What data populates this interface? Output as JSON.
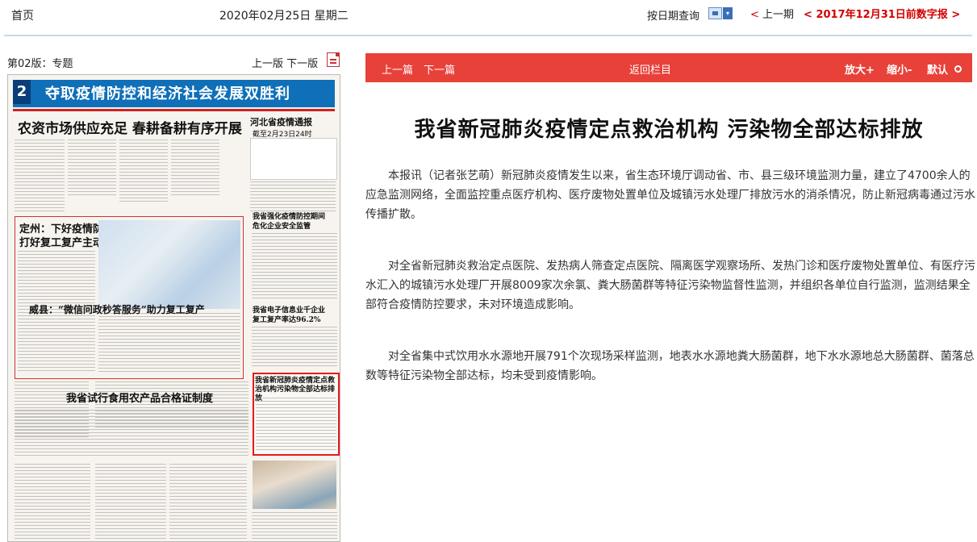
{
  "topbar": {
    "home": "首页",
    "date": "2020年02月25日 星期二",
    "query_by_date": "按日期查询",
    "calendar_icon": "calendar-icon",
    "prev_day_arrow": "<",
    "prev_day": "上一期",
    "back_to_2017_arrow": "<",
    "back_to_2017": "2017年12月31日前数字报",
    "back_to_2017_arrow_right": ">"
  },
  "left": {
    "section": "第02版：专题",
    "prev_page": "上一版",
    "next_page": "下一版",
    "pdf_icon": "pdf-icon",
    "paper": {
      "page_no": "2",
      "banner": "夺取疫情防控和经济社会发展双胜利",
      "headline_1": "农资市场供应充足 春耕备耕有序开展",
      "headline_right": "河北省疫情通报",
      "headline_right_2": "截至2月23日24时",
      "headline_2": "定州：下好疫情防控先手棋",
      "headline_2b": "打好复工复产主动仗",
      "headline_3": "威县：“微信问政秒答服务”助力复工复产",
      "headline_4": "我省试行食用农产品合格证制度",
      "headline_5": "我省强化疫情防控期间",
      "headline_5b": "危化企业安全监管",
      "headline_6": "我省电子信息业千企业",
      "headline_6b": "复工复产率达96.2%",
      "highlight_title": "我省新冠肺炎疫情定点救治机构污染物全部达标排放"
    }
  },
  "article": {
    "toolbar": {
      "prev": "上一篇",
      "next": "下一篇",
      "back": "返回栏目",
      "zoom_in": "放大+",
      "zoom_out": "缩小-",
      "default": "默认"
    },
    "title": "我省新冠肺炎疫情定点救治机构 污染物全部达标排放",
    "paragraphs": [
      "本报讯（记者张艺萌）新冠肺炎疫情发生以来，省生态环境厅调动省、市、县三级环境监测力量，建立了4700余人的应急监测网络，全面监控重点医疗机构、医疗废物处置单位及城镇污水处理厂排放污水的消杀情况，防止新冠病毒通过污水传播扩散。",
      "对全省新冠肺炎救治定点医院、发热病人筛查定点医院、隔离医学观察场所、发热门诊和医疗废物处置单位、有医疗污水汇入的城镇污水处理厂开展8009家次余氯、粪大肠菌群等特征污染物监督性监测，并组织各单位自行监测，监测结果全部符合疫情防控要求，未对环境造成影响。",
      "对全省集中式饮用水水源地开展791个次现场采样监测，地表水水源地粪大肠菌群，地下水水源地总大肠菌群、菌落总数等特征污染物全部达标，均未受到疫情影响。"
    ]
  }
}
